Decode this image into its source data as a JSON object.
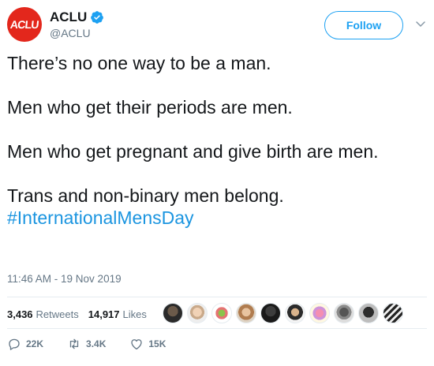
{
  "account": {
    "avatar_text": "ACLU",
    "display_name": "ACLU",
    "handle": "@ACLU",
    "verified": true,
    "brand_color": "#e3271c"
  },
  "follow_button": {
    "label": "Follow"
  },
  "tweet": {
    "paragraphs": [
      "There’s no one way to be a man.",
      "Men who get their periods are men.",
      "Men who get pregnant and give birth are men.",
      "Trans and non-binary men belong."
    ],
    "hashtag": "#InternationalMensDay",
    "timestamp": "11:46 AM - 19 Nov 2019"
  },
  "stats": {
    "retweets_count": "3,436",
    "retweets_label": "Retweets",
    "likes_count": "14,917",
    "likes_label": "Likes",
    "liker_avatar_count": 10
  },
  "actions": {
    "reply_count": "22K",
    "retweet_count": "3.4K",
    "like_count": "15K"
  },
  "colors": {
    "link": "#1b95e0",
    "accent": "#1da1f2",
    "muted": "#657786"
  },
  "icons": [
    "verified-badge-icon",
    "chevron-down-icon",
    "reply-icon",
    "retweet-icon",
    "heart-icon"
  ]
}
